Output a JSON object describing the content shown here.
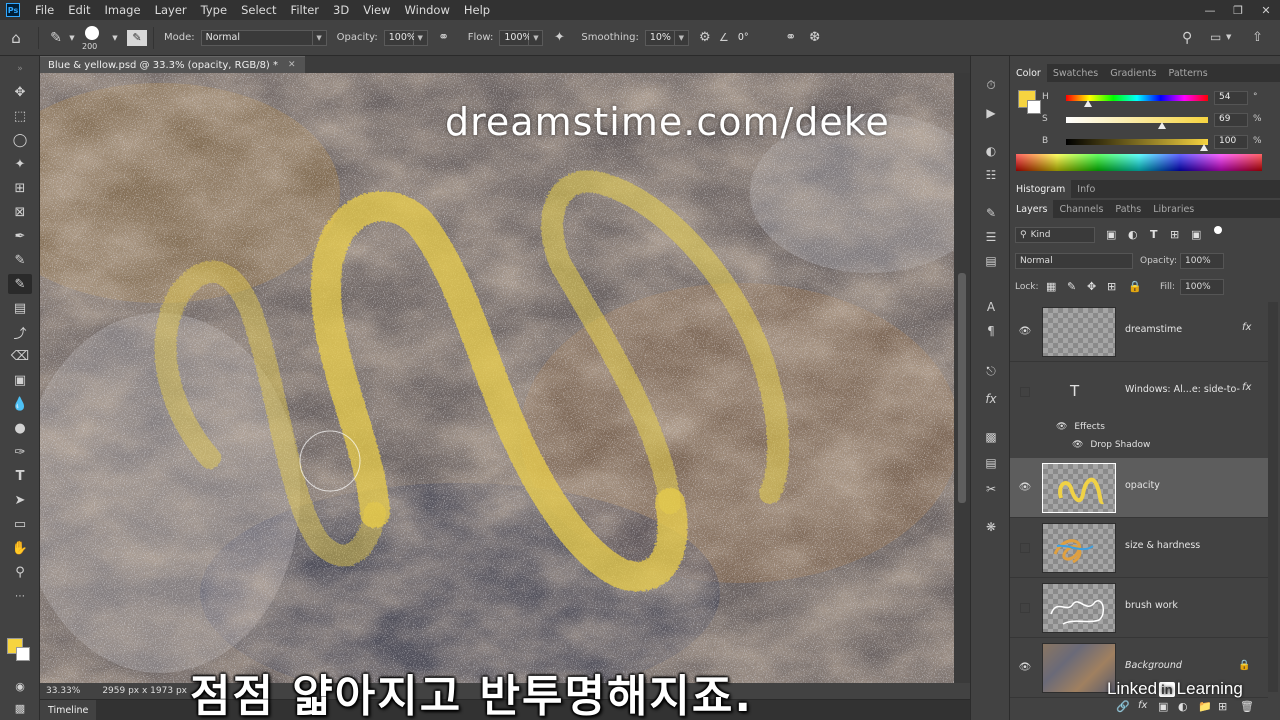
{
  "menu": [
    "File",
    "Edit",
    "Image",
    "Layer",
    "Type",
    "Select",
    "Filter",
    "3D",
    "View",
    "Window",
    "Help"
  ],
  "ps_logo": "Ps",
  "options": {
    "brush_size": "200",
    "mode_label": "Mode:",
    "mode_value": "Normal",
    "opacity_label": "Opacity:",
    "opacity_value": "100%",
    "flow_label": "Flow:",
    "flow_value": "100%",
    "smoothing_label": "Smoothing:",
    "smoothing_value": "10%",
    "angle_value": "0°"
  },
  "document": {
    "tab_title": "Blue & yellow.psd @ 33.3% (opacity, RGB/8) *",
    "watermark": "dreamstime.com/deke",
    "zoom": "33.33%",
    "doc_size": "2959 px x 1973 px"
  },
  "caption": "점점 얇아지고 반투명해지죠.",
  "timeline_label": "Timeline",
  "color_panel": {
    "tabs": [
      "Color",
      "Swatches",
      "Gradients",
      "Patterns"
    ],
    "h": "54",
    "s": "69",
    "b": "100",
    "h_unit": "°",
    "s_unit": "%",
    "b_unit": "%",
    "h_label": "H",
    "s_label": "S",
    "b_label": "B",
    "fg_color": "#f6d440"
  },
  "histogram_tabs": [
    "Histogram",
    "Info"
  ],
  "layers_panel": {
    "tabs": [
      "Layers",
      "Channels",
      "Paths",
      "Libraries"
    ],
    "kind_label": "Kind",
    "blend_mode": "Normal",
    "opacity_label": "Opacity:",
    "opacity_value": "100%",
    "lock_label": "Lock:",
    "fill_label": "Fill:",
    "fill_value": "100%",
    "layers": [
      {
        "name": "dreamstime",
        "visible": true,
        "fx": "fx"
      },
      {
        "name": "Windows: Al...e: side-to-",
        "visible": false,
        "fx": "fx"
      },
      {
        "name": "opacity",
        "visible": true,
        "selected": true
      },
      {
        "name": "size & hardness",
        "visible": false
      },
      {
        "name": "brush work",
        "visible": false
      },
      {
        "name": "Background",
        "visible": true
      }
    ],
    "effects_label": "Effects",
    "drop_shadow_label": "Drop Shadow"
  },
  "branding": {
    "linked": "Linked",
    "in": "in",
    "learning": "Learning"
  }
}
